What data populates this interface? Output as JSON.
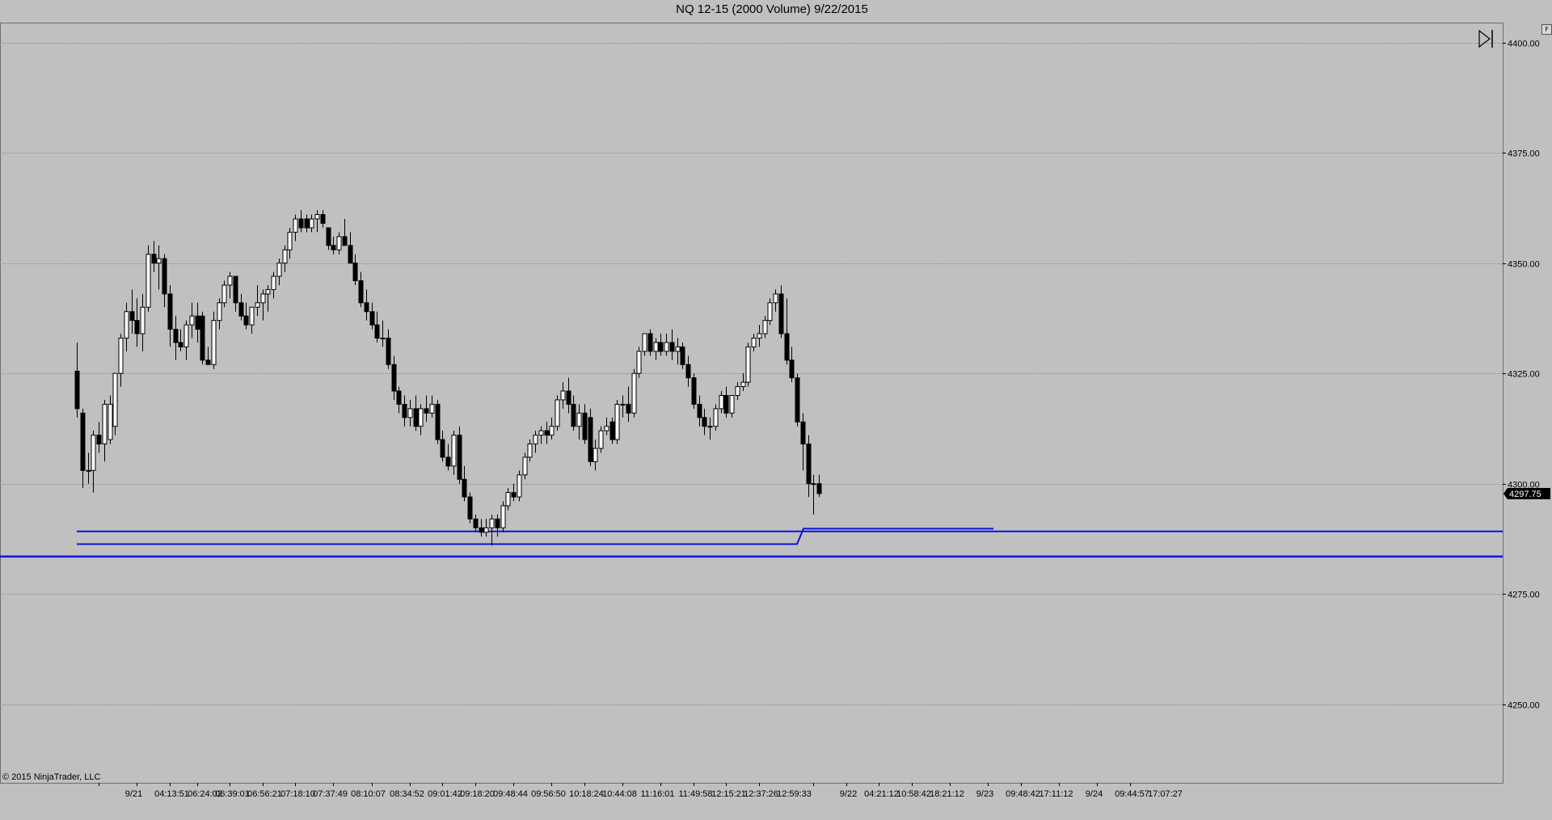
{
  "window": {
    "title": "NQ 12-15 (2000 Volume)  9/22/2015",
    "f_button_label": "F",
    "copyright": "© 2015 NinjaTrader, LLC"
  },
  "colors": {
    "background": "#c0c0c0",
    "grid": "#8c8c8c",
    "candle_up_fill": "#ffffff",
    "candle_down_fill": "#000000",
    "line": "#0a14d8",
    "price_marker_bg": "#000000",
    "price_marker_text": "#ffffff"
  },
  "icons": {
    "scroll_end": "skip-to-end-icon"
  },
  "chart_data": {
    "type": "candlestick",
    "instrument": "NQ 12-15",
    "bar_type": "2000 Volume",
    "date": "9/22/2015",
    "ylim": [
      4232.2,
      4404.5
    ],
    "y_ticks": [
      "4250.00",
      "4275.00",
      "4300.00",
      "4325.00",
      "4350.00",
      "4375.00",
      "4400.00"
    ],
    "y_tick_values": [
      4250,
      4275,
      4300,
      4325,
      4350,
      4375,
      4400
    ],
    "x_tick_labels": [
      "9/21",
      "04:13:51",
      "06:24:02",
      "06:39:01",
      "06:56:21",
      "07:18:10",
      "07:37:49",
      "08:10:07",
      "08:34:52",
      "09:01:42",
      "09:18:20",
      "09:48:44",
      "09:56:50",
      "10:18:24",
      "10:44:08",
      "11:16:01",
      "11:49:58",
      "12:15:21",
      "12:37:26",
      "12:59:33",
      "9/22",
      "04:21:12",
      "10:58:42",
      "18:21:12",
      "9/23",
      "09:48:42",
      "17:11:12",
      "9/24",
      "09:44:57",
      "17:07:27"
    ],
    "x_tick_bar_index": [
      4,
      11,
      17,
      22,
      28,
      34,
      40,
      47,
      54,
      61,
      67,
      73,
      80,
      87,
      93,
      100,
      107,
      113,
      119,
      125,
      135,
      141,
      147,
      153,
      160,
      167,
      173,
      180,
      187,
      193
    ],
    "last_price": "4297.75",
    "candles": [
      {
        "o": 4325.5,
        "h": 4332,
        "l": 4315,
        "c": 4317
      },
      {
        "o": 4316,
        "h": 4317,
        "l": 4299,
        "c": 4303
      },
      {
        "o": 4303,
        "h": 4307,
        "l": 4300,
        "c": 4303
      },
      {
        "o": 4303,
        "h": 4312,
        "l": 4298,
        "c": 4311
      },
      {
        "o": 4311,
        "h": 4314,
        "l": 4307,
        "c": 4309
      },
      {
        "o": 4309,
        "h": 4319,
        "l": 4305,
        "c": 4318
      },
      {
        "o": 4310,
        "h": 4320,
        "l": 4309,
        "c": 4318
      },
      {
        "o": 4313,
        "h": 4325,
        "l": 4311,
        "c": 4325
      },
      {
        "o": 4325,
        "h": 4334,
        "l": 4322,
        "c": 4333
      },
      {
        "o": 4333,
        "h": 4341,
        "l": 4330,
        "c": 4339
      },
      {
        "o": 4339,
        "h": 4344,
        "l": 4334,
        "c": 4337
      },
      {
        "o": 4337,
        "h": 4342,
        "l": 4331,
        "c": 4334
      },
      {
        "o": 4334,
        "h": 4343,
        "l": 4330,
        "c": 4340
      },
      {
        "o": 4340,
        "h": 4354,
        "l": 4339,
        "c": 4352
      },
      {
        "o": 4352,
        "h": 4355,
        "l": 4348,
        "c": 4350
      },
      {
        "o": 4350,
        "h": 4354,
        "l": 4344,
        "c": 4351
      },
      {
        "o": 4351,
        "h": 4352,
        "l": 4340,
        "c": 4343
      },
      {
        "o": 4343,
        "h": 4345,
        "l": 4331,
        "c": 4335
      },
      {
        "o": 4335,
        "h": 4338,
        "l": 4328,
        "c": 4332
      },
      {
        "o": 4332,
        "h": 4335,
        "l": 4330,
        "c": 4331
      },
      {
        "o": 4331,
        "h": 4337,
        "l": 4328,
        "c": 4336
      },
      {
        "o": 4336,
        "h": 4341,
        "l": 4333,
        "c": 4338
      },
      {
        "o": 4338,
        "h": 4341,
        "l": 4332,
        "c": 4335
      },
      {
        "o": 4338,
        "h": 4339,
        "l": 4327,
        "c": 4328
      },
      {
        "o": 4328,
        "h": 4331,
        "l": 4327,
        "c": 4327
      },
      {
        "o": 4327,
        "h": 4339,
        "l": 4326,
        "c": 4337
      },
      {
        "o": 4337,
        "h": 4342,
        "l": 4335,
        "c": 4341
      },
      {
        "o": 4341,
        "h": 4346,
        "l": 4340,
        "c": 4345
      },
      {
        "o": 4345,
        "h": 4348,
        "l": 4342,
        "c": 4347
      },
      {
        "o": 4347,
        "h": 4347,
        "l": 4339,
        "c": 4341
      },
      {
        "o": 4341,
        "h": 4343,
        "l": 4337,
        "c": 4338
      },
      {
        "o": 4338,
        "h": 4341,
        "l": 4335,
        "c": 4336
      },
      {
        "o": 4336,
        "h": 4340,
        "l": 4334,
        "c": 4340
      },
      {
        "o": 4340,
        "h": 4345,
        "l": 4338,
        "c": 4341
      },
      {
        "o": 4341,
        "h": 4344,
        "l": 4337,
        "c": 4343
      },
      {
        "o": 4343,
        "h": 4345,
        "l": 4339,
        "c": 4344
      },
      {
        "o": 4344,
        "h": 4348,
        "l": 4342,
        "c": 4347
      },
      {
        "o": 4347,
        "h": 4351,
        "l": 4345,
        "c": 4350
      },
      {
        "o": 4350,
        "h": 4354,
        "l": 4348,
        "c": 4353
      },
      {
        "o": 4353,
        "h": 4358,
        "l": 4351,
        "c": 4357
      },
      {
        "o": 4357,
        "h": 4361,
        "l": 4355,
        "c": 4360
      },
      {
        "o": 4360,
        "h": 4362,
        "l": 4357,
        "c": 4358
      },
      {
        "o": 4360,
        "h": 4361,
        "l": 4357,
        "c": 4358
      },
      {
        "o": 4358,
        "h": 4361,
        "l": 4357,
        "c": 4360
      },
      {
        "o": 4360,
        "h": 4362,
        "l": 4357,
        "c": 4361
      },
      {
        "o": 4361,
        "h": 4362,
        "l": 4358,
        "c": 4359
      },
      {
        "o": 4358,
        "h": 4358,
        "l": 4353,
        "c": 4354
      },
      {
        "o": 4354,
        "h": 4356,
        "l": 4352,
        "c": 4353
      },
      {
        "o": 4353,
        "h": 4357,
        "l": 4352,
        "c": 4356
      },
      {
        "o": 4356,
        "h": 4360,
        "l": 4354,
        "c": 4354
      },
      {
        "o": 4354,
        "h": 4357,
        "l": 4350,
        "c": 4350
      },
      {
        "o": 4350,
        "h": 4352,
        "l": 4345,
        "c": 4346
      },
      {
        "o": 4346,
        "h": 4348,
        "l": 4340,
        "c": 4341
      },
      {
        "o": 4341,
        "h": 4344,
        "l": 4337,
        "c": 4339
      },
      {
        "o": 4339,
        "h": 4341,
        "l": 4335,
        "c": 4336
      },
      {
        "o": 4336,
        "h": 4339,
        "l": 4332,
        "c": 4333
      },
      {
        "o": 4333,
        "h": 4337,
        "l": 4331,
        "c": 4333
      },
      {
        "o": 4333,
        "h": 4335,
        "l": 4326,
        "c": 4327
      },
      {
        "o": 4327,
        "h": 4329,
        "l": 4319,
        "c": 4321
      },
      {
        "o": 4321,
        "h": 4322,
        "l": 4316,
        "c": 4318
      },
      {
        "o": 4318,
        "h": 4320,
        "l": 4313,
        "c": 4315
      },
      {
        "o": 4315,
        "h": 4319,
        "l": 4313,
        "c": 4317
      },
      {
        "o": 4317,
        "h": 4320,
        "l": 4312,
        "c": 4313
      },
      {
        "o": 4313,
        "h": 4318,
        "l": 4311,
        "c": 4317
      },
      {
        "o": 4317,
        "h": 4320,
        "l": 4314,
        "c": 4316
      },
      {
        "o": 4316,
        "h": 4320,
        "l": 4315,
        "c": 4318
      },
      {
        "o": 4318,
        "h": 4319,
        "l": 4309,
        "c": 4310
      },
      {
        "o": 4310,
        "h": 4312,
        "l": 4305,
        "c": 4306
      },
      {
        "o": 4306,
        "h": 4309,
        "l": 4303,
        "c": 4304
      },
      {
        "o": 4304,
        "h": 4312,
        "l": 4302,
        "c": 4311
      },
      {
        "o": 4311,
        "h": 4313,
        "l": 4300,
        "c": 4301
      },
      {
        "o": 4301,
        "h": 4304,
        "l": 4296,
        "c": 4297
      },
      {
        "o": 4297,
        "h": 4298,
        "l": 4291,
        "c": 4292
      },
      {
        "o": 4292,
        "h": 4293,
        "l": 4289,
        "c": 4290
      },
      {
        "o": 4290,
        "h": 4292,
        "l": 4288,
        "c": 4289
      },
      {
        "o": 4289,
        "h": 4292,
        "l": 4288,
        "c": 4290
      },
      {
        "o": 4290,
        "h": 4293,
        "l": 4286,
        "c": 4292
      },
      {
        "o": 4292,
        "h": 4293,
        "l": 4288,
        "c": 4290
      },
      {
        "o": 4290,
        "h": 4296,
        "l": 4289,
        "c": 4295
      },
      {
        "o": 4295,
        "h": 4299,
        "l": 4294,
        "c": 4298
      },
      {
        "o": 4298,
        "h": 4300,
        "l": 4296,
        "c": 4297
      },
      {
        "o": 4297,
        "h": 4303,
        "l": 4296,
        "c": 4302
      },
      {
        "o": 4302,
        "h": 4307,
        "l": 4301,
        "c": 4306
      },
      {
        "o": 4306,
        "h": 4310,
        "l": 4305,
        "c": 4309
      },
      {
        "o": 4309,
        "h": 4312,
        "l": 4307,
        "c": 4311
      },
      {
        "o": 4311,
        "h": 4313,
        "l": 4309,
        "c": 4312
      },
      {
        "o": 4312,
        "h": 4314,
        "l": 4309,
        "c": 4311
      },
      {
        "o": 4311,
        "h": 4315,
        "l": 4310,
        "c": 4313
      },
      {
        "o": 4313,
        "h": 4320,
        "l": 4312,
        "c": 4319
      },
      {
        "o": 4319,
        "h": 4323,
        "l": 4317,
        "c": 4321
      },
      {
        "o": 4321,
        "h": 4324,
        "l": 4316,
        "c": 4318
      },
      {
        "o": 4318,
        "h": 4320,
        "l": 4312,
        "c": 4313
      },
      {
        "o": 4313,
        "h": 4318,
        "l": 4310,
        "c": 4316
      },
      {
        "o": 4316,
        "h": 4318,
        "l": 4309,
        "c": 4310
      },
      {
        "o": 4315,
        "h": 4317,
        "l": 4304,
        "c": 4305
      },
      {
        "o": 4305,
        "h": 4310,
        "l": 4303,
        "c": 4308
      },
      {
        "o": 4308,
        "h": 4313,
        "l": 4307,
        "c": 4312
      },
      {
        "o": 4312,
        "h": 4315,
        "l": 4311,
        "c": 4313
      },
      {
        "o": 4314,
        "h": 4315,
        "l": 4309,
        "c": 4310
      },
      {
        "o": 4310,
        "h": 4319,
        "l": 4309,
        "c": 4318
      },
      {
        "o": 4318,
        "h": 4320,
        "l": 4315,
        "c": 4318
      },
      {
        "o": 4318,
        "h": 4322,
        "l": 4314,
        "c": 4316
      },
      {
        "o": 4316,
        "h": 4326,
        "l": 4315,
        "c": 4325
      },
      {
        "o": 4325,
        "h": 4331,
        "l": 4324,
        "c": 4330
      },
      {
        "o": 4330,
        "h": 4334,
        "l": 4329,
        "c": 4334
      },
      {
        "o": 4334,
        "h": 4335,
        "l": 4329,
        "c": 4330
      },
      {
        "o": 4330,
        "h": 4333,
        "l": 4328,
        "c": 4332
      },
      {
        "o": 4332,
        "h": 4334,
        "l": 4329,
        "c": 4330
      },
      {
        "o": 4330,
        "h": 4334,
        "l": 4329,
        "c": 4332
      },
      {
        "o": 4332,
        "h": 4335,
        "l": 4328,
        "c": 4330
      },
      {
        "o": 4330,
        "h": 4333,
        "l": 4327,
        "c": 4331
      },
      {
        "o": 4331,
        "h": 4332,
        "l": 4326,
        "c": 4327
      },
      {
        "o": 4327,
        "h": 4329,
        "l": 4322,
        "c": 4324
      },
      {
        "o": 4324,
        "h": 4325,
        "l": 4317,
        "c": 4318
      },
      {
        "o": 4318,
        "h": 4320,
        "l": 4313,
        "c": 4315
      },
      {
        "o": 4315,
        "h": 4317,
        "l": 4311,
        "c": 4313
      },
      {
        "o": 4313,
        "h": 4315,
        "l": 4310,
        "c": 4313
      },
      {
        "o": 4313,
        "h": 4318,
        "l": 4312,
        "c": 4317
      },
      {
        "o": 4317,
        "h": 4321,
        "l": 4316,
        "c": 4320
      },
      {
        "o": 4320,
        "h": 4322,
        "l": 4315,
        "c": 4316
      },
      {
        "o": 4316,
        "h": 4320,
        "l": 4315,
        "c": 4320
      },
      {
        "o": 4320,
        "h": 4323,
        "l": 4319,
        "c": 4322
      },
      {
        "o": 4322,
        "h": 4325,
        "l": 4321,
        "c": 4323
      },
      {
        "o": 4323,
        "h": 4332,
        "l": 4322,
        "c": 4331
      },
      {
        "o": 4331,
        "h": 4334,
        "l": 4330,
        "c": 4333
      },
      {
        "o": 4333,
        "h": 4336,
        "l": 4331,
        "c": 4334
      },
      {
        "o": 4334,
        "h": 4338,
        "l": 4333,
        "c": 4337
      },
      {
        "o": 4337,
        "h": 4342,
        "l": 4336,
        "c": 4341
      },
      {
        "o": 4341,
        "h": 4344,
        "l": 4339,
        "c": 4343
      },
      {
        "o": 4343,
        "h": 4345,
        "l": 4333,
        "c": 4334
      },
      {
        "o": 4334,
        "h": 4342,
        "l": 4327,
        "c": 4328
      },
      {
        "o": 4328,
        "h": 4331,
        "l": 4323,
        "c": 4324
      },
      {
        "o": 4324,
        "h": 4325,
        "l": 4313,
        "c": 4314
      },
      {
        "o": 4314,
        "h": 4316,
        "l": 4303,
        "c": 4309
      },
      {
        "o": 4309,
        "h": 4311,
        "l": 4297,
        "c": 4300
      },
      {
        "o": 4300,
        "h": 4302,
        "l": 4293,
        "c": 4300
      },
      {
        "o": 4300,
        "h": 4302,
        "l": 4297,
        "c": 4297.75
      }
    ],
    "lines": [
      {
        "kind": "horizontal-segment",
        "start_bar": 0,
        "value": 4289.2
      },
      {
        "kind": "step-line",
        "start_bar": 0,
        "step_bar": 132,
        "value_before": 4286.3,
        "value_after": 4289.8,
        "end_bar": 168
      },
      {
        "kind": "horizontal-full",
        "value": 4283.5
      }
    ]
  }
}
